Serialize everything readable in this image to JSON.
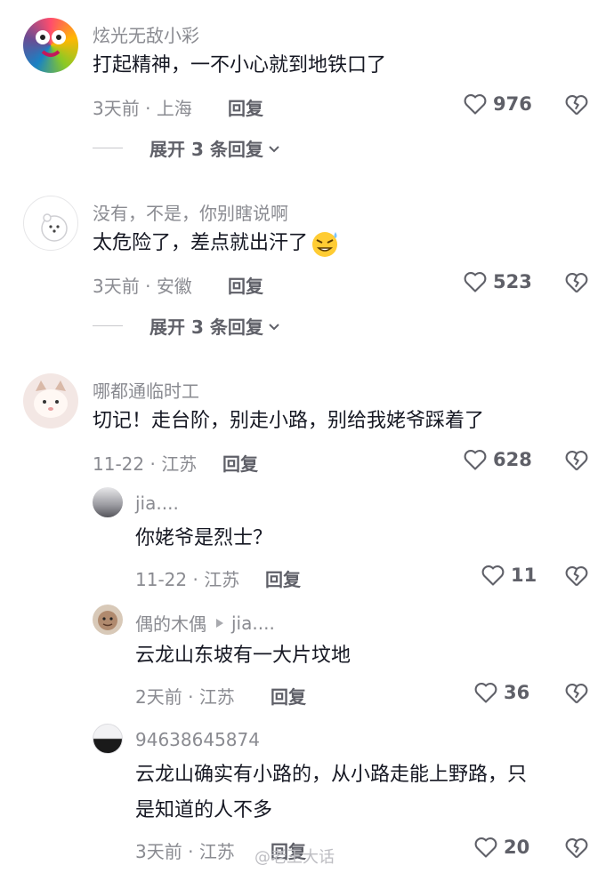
{
  "comments": [
    {
      "username": "炫光无敌小彩",
      "text": "打起精神，一不小心就到地铁口了",
      "time": "3天前",
      "location": "上海",
      "reply_label": "回复",
      "likes": "976",
      "expand_label": "展开 3 条回复"
    },
    {
      "username": "没有，不是，你别瞎说啊",
      "text": "太危险了，差点就出汗了",
      "time": "3天前",
      "location": "安徽",
      "reply_label": "回复",
      "likes": "523",
      "expand_label": "展开 3 条回复"
    },
    {
      "username": "哪都通临时工",
      "text": "切记！走台阶，别走小路，别给我姥爷踩着了",
      "time": "11-22",
      "location": "江苏",
      "reply_label": "回复",
      "likes": "628"
    }
  ],
  "replies": [
    {
      "username": "jia....",
      "text": "你姥爷是烈士？",
      "time": "11-22",
      "location": "江苏",
      "reply_label": "回复",
      "likes": "11"
    },
    {
      "username": "偶的木偶",
      "reply_to": "jia....",
      "text": "云龙山东坡有一大片坟地",
      "time": "2天前",
      "location": "江苏",
      "reply_label": "回复",
      "likes": "36"
    },
    {
      "username": "94638645874",
      "text_line1": "云龙山确实有小路的，从小路走能上野路，只",
      "text_line2": "是知道的人不多",
      "time": "3天前",
      "location": "江苏",
      "reply_label": "回复",
      "likes": "20"
    }
  ],
  "watermark": "@老王大话",
  "icons": {
    "like": "heart-outline-icon",
    "dislike": "broken-heart-icon",
    "expand": "chevron-down-icon",
    "emoji": "sweat-emoji-icon",
    "reply_arrow": "triangle-right-icon"
  }
}
